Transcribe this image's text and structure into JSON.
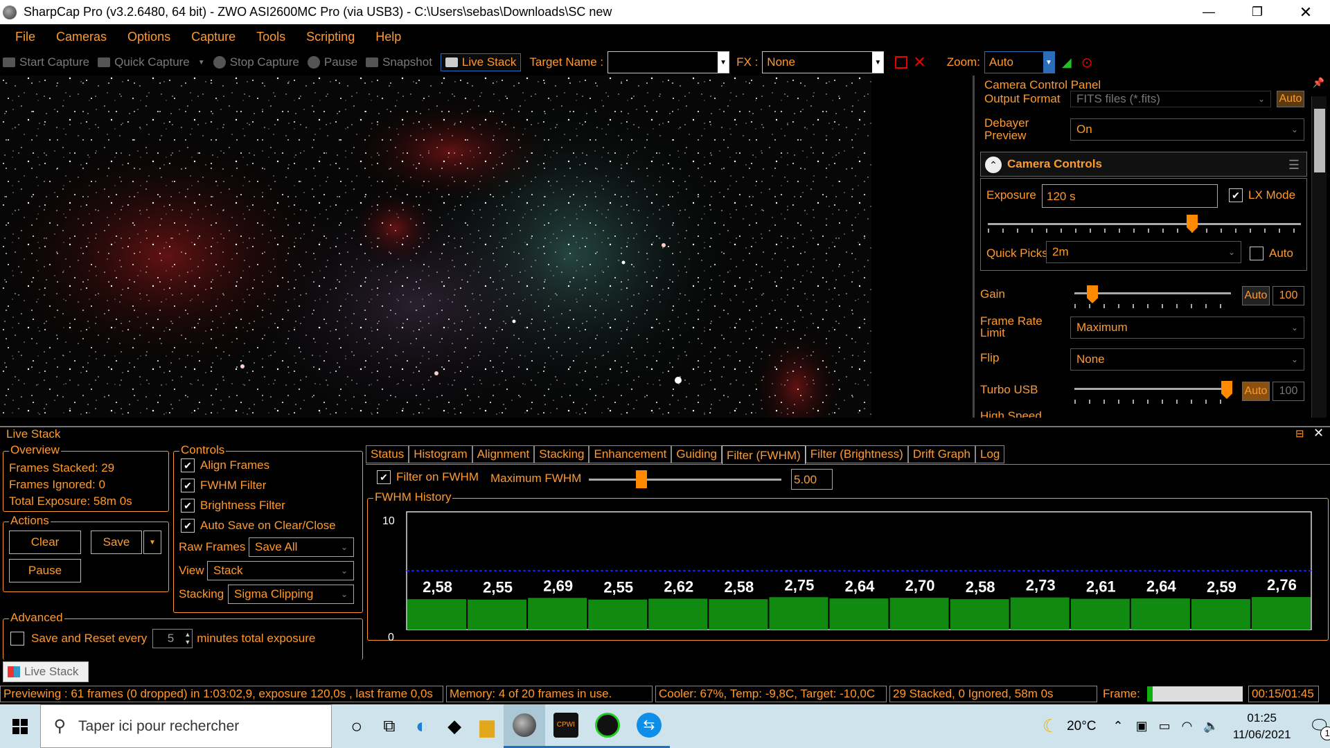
{
  "window": {
    "title": "SharpCap Pro (v3.2.6480, 64 bit) - ZWO ASI2600MC Pro (via USB3) - C:\\Users\\sebas\\Downloads\\SC new"
  },
  "menu": [
    "File",
    "Cameras",
    "Options",
    "Capture",
    "Tools",
    "Scripting",
    "Help"
  ],
  "toolbar": {
    "start_capture": "Start Capture",
    "quick_capture": "Quick Capture",
    "stop_capture": "Stop Capture",
    "pause": "Pause",
    "snapshot": "Snapshot",
    "live_stack": "Live Stack",
    "target_label": "Target Name :",
    "target_value": "",
    "fx_label": "FX :",
    "fx_value": "None",
    "zoom_label": "Zoom:",
    "zoom_value": "Auto"
  },
  "panel": {
    "title": "Camera Control Panel",
    "output_format_label": "Output Format",
    "output_format_value": "FITS files (*.fits)",
    "output_auto": "Auto",
    "debayer_label": "Debayer Preview",
    "debayer_value": "On",
    "section": "Camera Controls",
    "exposure_label": "Exposure",
    "exposure_value": "120 s",
    "lx_label": "LX Mode",
    "quickpicks_label": "Quick Picks",
    "quickpicks_value": "2m",
    "quickpicks_auto": "Auto",
    "gain_label": "Gain",
    "gain_auto": "Auto",
    "gain_value": "100",
    "framerate_label": "Frame Rate Limit",
    "framerate_value": "Maximum",
    "flip_label": "Flip",
    "flip_value": "None",
    "turbo_label": "Turbo USB",
    "turbo_auto": "Auto",
    "turbo_value": "100",
    "highspeed_label": "High Speed"
  },
  "livestack": {
    "title": "Live Stack",
    "overview": {
      "label": "Overview",
      "stacked": "Frames Stacked: 29",
      "ignored": "Frames Ignored:  0",
      "exposure": "Total Exposure:  58m 0s"
    },
    "actions": {
      "label": "Actions",
      "clear": "Clear",
      "save": "Save",
      "pause": "Pause"
    },
    "advanced": {
      "label": "Advanced",
      "save_reset": "Save and Reset every",
      "minutes_value": "5",
      "minutes_label": "minutes total exposure"
    },
    "controls": {
      "label": "Controls",
      "align": "Align Frames",
      "fwhm": "FWHM Filter",
      "brightness": "Brightness Filter",
      "autosave": "Auto Save on Clear/Close",
      "raw_label": "Raw Frames",
      "raw_value": "Save All",
      "view_label": "View",
      "view_value": "Stack",
      "stacking_label": "Stacking",
      "stacking_value": "Sigma Clipping"
    },
    "tabs": [
      "Status",
      "Histogram",
      "Alignment",
      "Stacking",
      "Enhancement",
      "Guiding",
      "Filter (FWHM)",
      "Filter (Brightness)",
      "Drift Graph",
      "Log"
    ],
    "selected_tab": "Filter (FWHM)",
    "filter": {
      "filter_on": "Filter on FWHM",
      "max_label": "Maximum FWHM",
      "max_value": "5.00",
      "max_fraction": 0.26,
      "history_label": "FWHM History"
    },
    "bottom_tab": "Live Stack"
  },
  "chart_data": {
    "type": "bar",
    "title": "FWHM History",
    "ylim": [
      0,
      10
    ],
    "yticks": [
      "10",
      "0"
    ],
    "threshold": 5.0,
    "labels": [
      "2,58",
      "2,55",
      "2,69",
      "2,55",
      "2,62",
      "2,58",
      "2,75",
      "2,64",
      "2,70",
      "2,58",
      "2,73",
      "2,61",
      "2,64",
      "2,59",
      "2,76"
    ],
    "values": [
      2.58,
      2.55,
      2.69,
      2.55,
      2.62,
      2.58,
      2.75,
      2.64,
      2.7,
      2.58,
      2.73,
      2.61,
      2.64,
      2.59,
      2.76
    ],
    "bar_color": "#118a11",
    "threshold_color": "#1a1aff"
  },
  "statusbar": {
    "preview": "Previewing : 61 frames (0 dropped) in 1:03:02,9, exposure 120,0s , last frame 0,0s",
    "memory": "Memory: 4 of 20 frames in use.",
    "cooler": "Cooler: 67%, Temp: -9,8C, Target: -10,0C",
    "stack": "29 Stacked, 0 Ignored, 58m 0s",
    "frame_label": "Frame:",
    "frame_progress": 0.06,
    "time": "00:15/01:45"
  },
  "taskbar": {
    "search": "Taper ici pour rechercher",
    "temp": "20°C",
    "time": "01:25",
    "date": "11/06/2021",
    "notif": "1"
  }
}
